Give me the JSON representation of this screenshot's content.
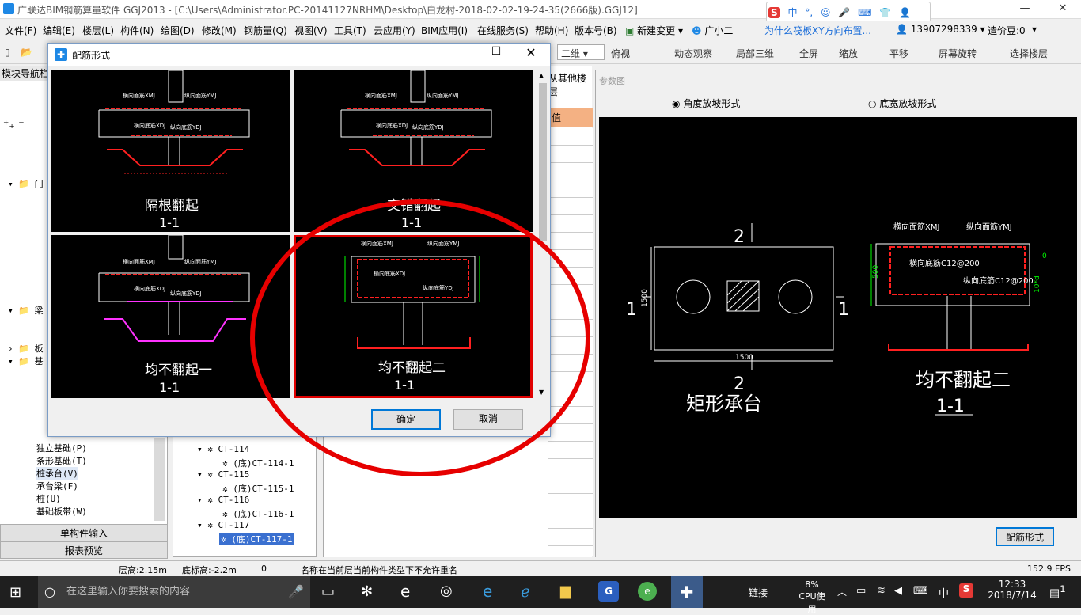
{
  "window": {
    "title": "广联达BIM钢筋算量软件 GGJ2013 - [C:\\Users\\Administrator.PC-20141127NRHM\\Desktop\\白龙村-2018-02-02-19-24-35(2666版).GGJ12]",
    "min": "—",
    "max": "❐",
    "close": "✕"
  },
  "ime": {
    "logo": "S",
    "items": [
      "中",
      "°,",
      "☺",
      "🎤",
      "⌨",
      "👕",
      "👤",
      "🔧"
    ]
  },
  "menu": [
    "文件(F)",
    "编辑(E)",
    "楼层(L)",
    "构件(N)",
    "绘图(D)",
    "修改(M)",
    "钢筋量(Q)",
    "视图(V)",
    "工具(T)",
    "云应用(Y)",
    "BIM应用(I)",
    "在线服务(S)",
    "帮助(H)",
    "版本号(B)",
    "新建变更",
    "广小二"
  ],
  "menu_right": {
    "question": "为什么筏板XY方向布置...",
    "phone": "13907298339",
    "price": "造价豆:0"
  },
  "toolbar": {
    "view_mode": "二维",
    "items": [
      "俯视",
      "动态观察",
      "局部三维",
      "全屏",
      "缩放",
      "平移",
      "屏幕旋转",
      "选择楼层"
    ]
  },
  "nav": {
    "header": "模块导航栏",
    "items": [
      {
        "label": "门",
        "indent": 1,
        "expanded": true
      },
      {
        "label": "梁",
        "indent": 1,
        "expanded": true
      },
      {
        "label": "板",
        "indent": 1,
        "expanded": false
      },
      {
        "label": "基",
        "indent": 1,
        "expanded": true
      },
      {
        "label": "独立基础(P)",
        "indent": 2
      },
      {
        "label": "条形基础(T)",
        "indent": 2
      },
      {
        "label": "桩承台(V)",
        "indent": 2
      },
      {
        "label": "承台梁(F)",
        "indent": 2
      },
      {
        "label": "桩(U)",
        "indent": 2
      },
      {
        "label": "基础板带(W)",
        "indent": 2
      }
    ],
    "btn_single": "单构件输入",
    "btn_report": "报表预览"
  },
  "comp_tree": [
    {
      "label": "CT-114",
      "child": "(底)CT-114-1"
    },
    {
      "label": "CT-115",
      "child": "(底)CT-115-1"
    },
    {
      "label": "CT-116",
      "child": "(底)CT-116-1"
    },
    {
      "label": "CT-117",
      "child": "(底)CT-117-1"
    }
  ],
  "prop": {
    "tab": "从其他楼层",
    "header": "值"
  },
  "param": {
    "title": "参数图",
    "radio1": "角度放坡形式",
    "radio2": "底宽放坡形式",
    "radio_selected": 1,
    "btn": "配筋形式",
    "plan": {
      "label_top": "2",
      "label_bottom": "2",
      "label_left": "1",
      "label_right": "1",
      "dim_w": "1500",
      "dim_h": "1500",
      "name": "矩形承台"
    },
    "section": {
      "name": "均不翻起二",
      "sub": "1-1",
      "h": "500",
      "lbl1": "横向面筋XMJ",
      "lbl2": "纵向面筋YMJ",
      "lbl3": "横向底筋C12@200",
      "lbl4": "纵向底筋C12@200",
      "lbl5": "0",
      "lbl6": "10*d"
    }
  },
  "dialog": {
    "title": "配筋形式",
    "min": "—",
    "max": "☐",
    "close": "✕",
    "tiles": [
      {
        "name": "隔根翻起",
        "sub": "1-1",
        "selected": false
      },
      {
        "name": "交错翻起",
        "sub": "1-1",
        "selected": false
      },
      {
        "name": "均不翻起一",
        "sub": "1-1",
        "selected": false
      },
      {
        "name": "均不翻起二",
        "sub": "1-1",
        "selected": true
      }
    ],
    "tile_labels": {
      "xmj": "横向面筋XMJ",
      "ymj": "纵向面筋YMJ",
      "xdj": "横向底筋XDJ",
      "ydj": "纵向底筋YDJ"
    },
    "ok": "确定",
    "cancel": "取消"
  },
  "status": {
    "floor_h": "层高:2.15m",
    "bottom_h": "底标高:-2.2m",
    "zero": "0",
    "msg": "名称在当前层当前构件类型下不允许重名",
    "fps": "152.9 FPS"
  },
  "taskbar": {
    "search": "在这里输入你要搜索的内容",
    "link": "链接",
    "cpu_pct": "8%",
    "cpu_label": "CPU使用",
    "ime": "中",
    "time": "12:33",
    "date": "2018/7/14",
    "notif": "1"
  },
  "colors": {
    "accent": "#0078d7",
    "highlight": "#e60000",
    "cad_green": "#00ff00",
    "cad_red": "#ff2020"
  }
}
